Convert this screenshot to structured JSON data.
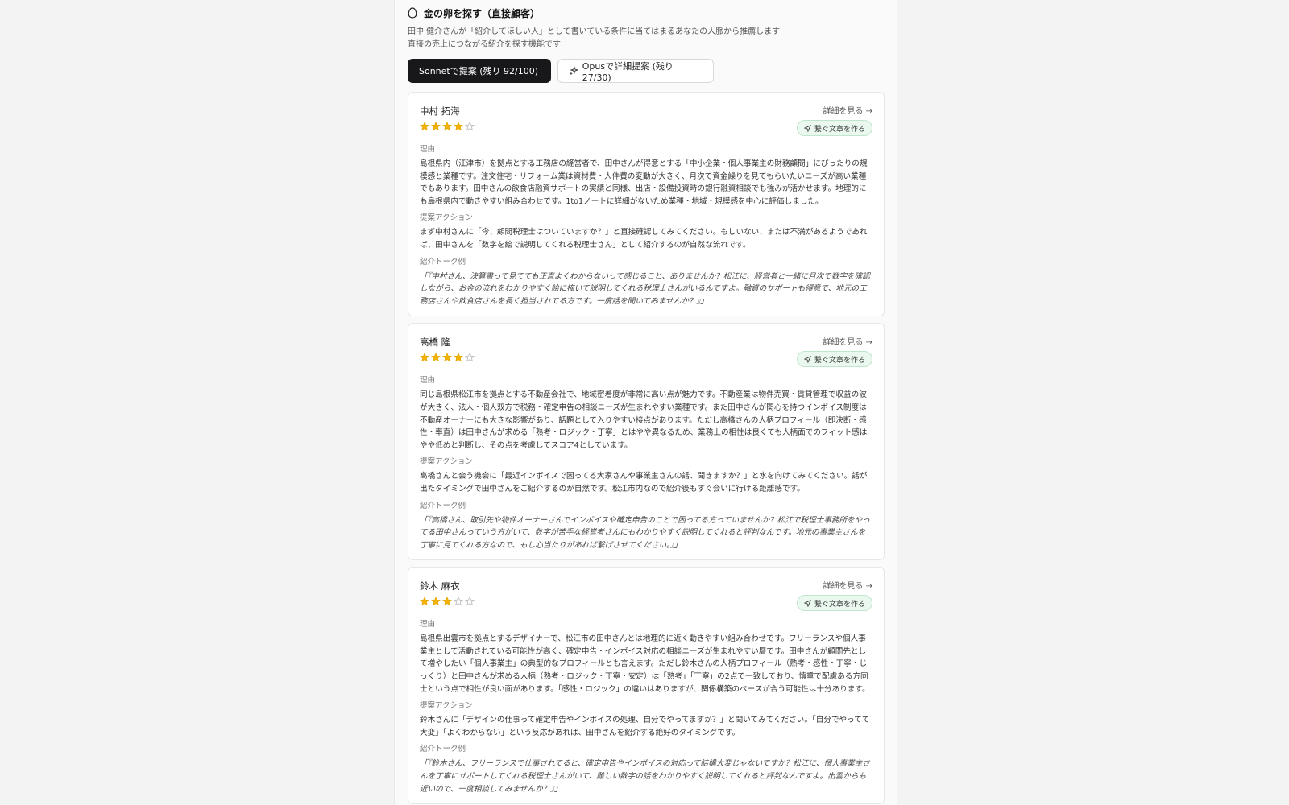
{
  "header": {
    "title": "金の卵を探す（直接顧客）",
    "desc_line1": "田中 健介さんが「紹介してほしい人」として書いている条件に当てはまるあなたの人脈から推薦します",
    "desc_line2": "直接の売上につながる紹介を探す機能です"
  },
  "buttons": {
    "sonnet_label": "Sonnetで提案 (残り 92/100)",
    "opus_label": "Opusで詳細提案 (残り 27/30)"
  },
  "cards": [
    {
      "name": "中村 拓海",
      "rating": 4,
      "detail_label": "詳細を見る →",
      "connect_label": "繋ぐ文章を作る",
      "reason_label": "理由",
      "reason": "島根県内（江津市）を拠点とする工務店の経営者で、田中さんが得意とする「中小企業・個人事業主の財務顧問」にぴったりの規模感と業種です。注文住宅・リフォーム業は資材費・人件費の変動が大きく、月次で資金繰りを見てもらいたいニーズが高い業種でもあります。田中さんの飲食店融資サポートの実績と同様、出店・設備投資時の銀行融資相談でも強みが活かせます。地理的にも島根県内で動きやすい組み合わせです。1to1ノートに詳細がないため業種・地域・規模感を中心に評価しました。",
      "action_label": "提案アクション",
      "action": "まず中村さんに「今、顧問税理士はついていますか？」と直接確認してみてください。もしいない、または不満があるようであれば、田中さんを「数字を絵で説明してくれる税理士さん」として紹介するのが自然な流れです。",
      "talk_label": "紹介トーク例",
      "talk": "「『中村さん、決算書って見てても正直よくわからないって感じること、ありませんか？松江に、経営者と一緒に月次で数字を確認しながら、お金の流れをわかりやすく絵に描いて説明してくれる税理士さんがいるんですよ。融資のサポートも得意で、地元の工務店さんや飲食店さんを長く担当されてる方です。一度話を聞いてみませんか？』」"
    },
    {
      "name": "高橋 隆",
      "rating": 4,
      "detail_label": "詳細を見る →",
      "connect_label": "繋ぐ文章を作る",
      "reason_label": "理由",
      "reason": "同じ島根県松江市を拠点とする不動産会社で、地域密着度が非常に高い点が魅力です。不動産業は物件売買・賃貸管理で収益の波が大きく、法人・個人双方で税務・確定申告の相談ニーズが生まれやすい業種です。また田中さんが関心を持つインボイス制度は不動産オーナーにも大きな影響があり、話題として入りやすい接点があります。ただし高橋さんの人柄プロフィール（即決断・感性・率直）は田中さんが求める「熟考・ロジック・丁寧」とはやや異なるため、業務上の相性は良くても人柄面でのフィット感はやや低めと判断し、その点を考慮してスコア4としています。",
      "action_label": "提案アクション",
      "action": "高橋さんと会う機会に「最近インボイスで困ってる大家さんや事業主さんの話、聞きますか？」と水を向けてみてください。話が出たタイミングで田中さんをご紹介するのが自然です。松江市内なので紹介後もすぐ会いに行ける距離感です。",
      "talk_label": "紹介トーク例",
      "talk": "「『高橋さん、取引先や物件オーナーさんでインボイスや確定申告のことで困ってる方っていませんか？松江で税理士事務所をやってる田中さんっていう方がいて、数字が苦手な経営者さんにもわかりやすく説明してくれると評判なんです。地元の事業主さんを丁寧に見てくれる方なので、もし心当たりがあれば繋げさせてください。』」"
    },
    {
      "name": "鈴木 麻衣",
      "rating": 3,
      "detail_label": "詳細を見る →",
      "connect_label": "繋ぐ文章を作る",
      "reason_label": "理由",
      "reason": "島根県出雲市を拠点とするデザイナーで、松江市の田中さんとは地理的に近く動きやすい組み合わせです。フリーランスや個人事業主として活動されている可能性が高く、確定申告・インボイス対応の相談ニーズが生まれやすい層です。田中さんが顧問先として増やしたい「個人事業主」の典型的なプロフィールとも言えます。ただし鈴木さんの人柄プロフィール（熟考・感性・丁寧・じっくり）と田中さんが求める人柄（熟考・ロジック・丁寧・安定）は「熟考」「丁寧」の2点で一致しており、慎重で配慮ある方同士という点で相性が良い面があります。「感性・ロジック」の違いはありますが、関係構築のペースが合う可能性は十分あります。",
      "action_label": "提案アクション",
      "action": "鈴木さんに「デザインの仕事って確定申告やインボイスの処理、自分でやってますか？」と聞いてみてください。「自分でやってて大変」「よくわからない」という反応があれば、田中さんを紹介する絶好のタイミングです。",
      "talk_label": "紹介トーク例",
      "talk": "「『鈴木さん、フリーランスで仕事されてると、確定申告やインボイスの対応って結構大変じゃないですか？松江に、個人事業主さんを丁寧にサポートしてくれる税理士さんがいて、難しい数字の話をわかりやすく説明してくれると評判なんですよ。出雲からも近いので、一度相談してみませんか？』」"
    }
  ]
}
